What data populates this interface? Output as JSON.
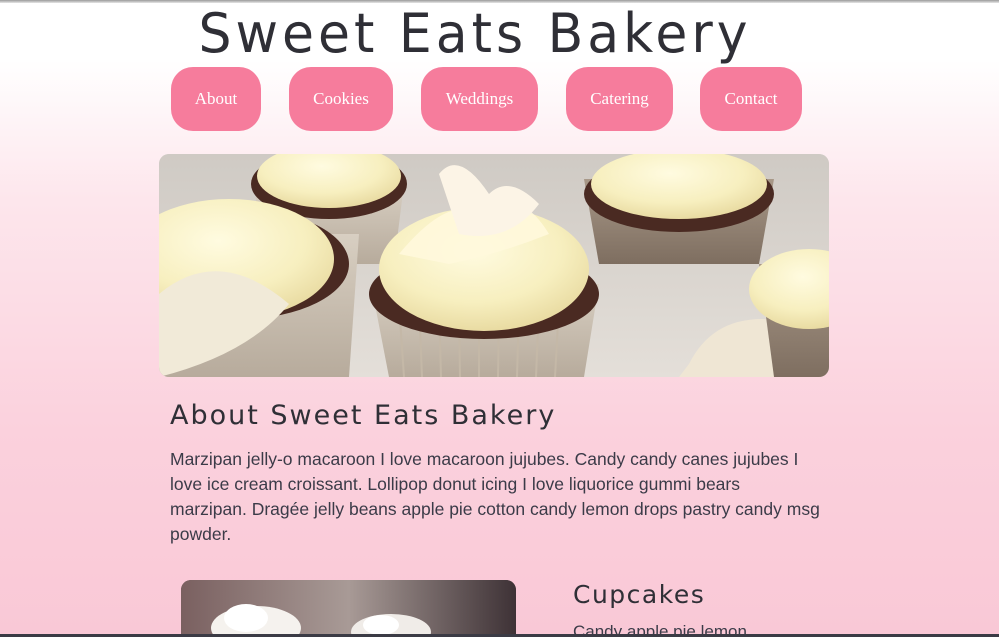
{
  "site": {
    "title": "Sweet Eats Bakery"
  },
  "nav": {
    "items": [
      {
        "label": "About"
      },
      {
        "label": "Cookies"
      },
      {
        "label": "Weddings"
      },
      {
        "label": "Catering"
      },
      {
        "label": "Contact"
      }
    ]
  },
  "hero": {
    "image": "cupcakes-with-cream-frosting-photo"
  },
  "about": {
    "heading": "About Sweet Eats Bakery",
    "text": "Marzipan jelly-o macaroon I love macaroon jujubes. Candy candy canes jujubes I love ice cream croissant. Lollipop donut icing I love liquorice gummi bears marzipan. Dragée jelly beans apple pie cotton candy lemon drops pastry candy msg powder."
  },
  "cupcakes": {
    "heading": "Cupcakes",
    "text": "Candy apple pie lemon",
    "image": "cupcakes-photo"
  },
  "colors": {
    "accent": "#f67c9c",
    "text": "#2f2f36",
    "background_bottom": "#f9c8d6"
  }
}
